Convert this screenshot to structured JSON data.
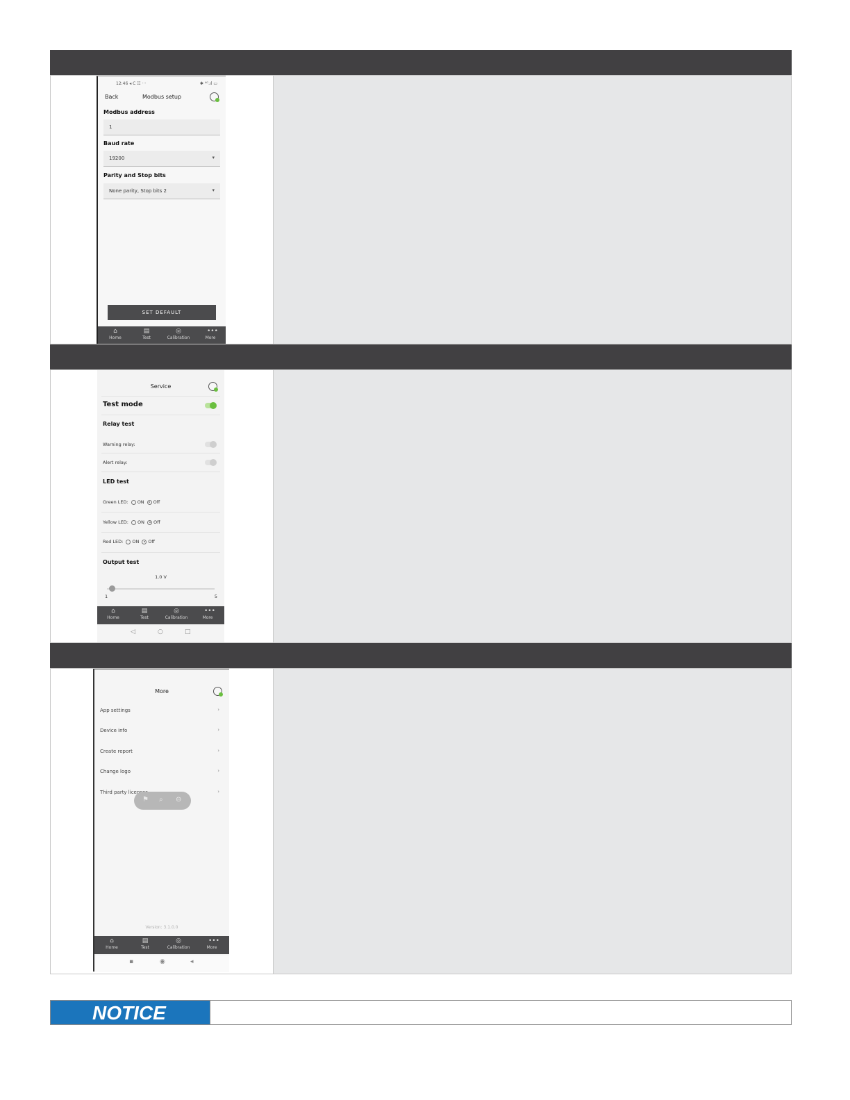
{
  "modbus_screen": {
    "status_left": "12:46 ◂ C ☷ ···",
    "status_right": "✱ ⁴ᴳ.ıl ▭",
    "back": "Back",
    "title": "Modbus setup",
    "address_label": "Modbus address",
    "address_value": "1",
    "baud_label": "Baud rate",
    "baud_value": "19200",
    "parity_label": "Parity and Stop bits",
    "parity_value": "None parity, Stop bits 2",
    "dropdown_glyph": "▾",
    "default_button": "SET DEFAULT"
  },
  "service_screen": {
    "title": "Service",
    "test_mode": "Test mode",
    "relay_test": "Relay test",
    "warning_relay": "Warning relay:",
    "alert_relay": "Alert relay:",
    "led_test": "LED test",
    "green_led": "Green LED:",
    "yellow_led": "Yellow LED:",
    "red_led": "Red LED:",
    "on_label": "ON",
    "off_label": "Off",
    "output_test": "Output test",
    "output_value": "1.0 V",
    "slider_min": "1",
    "slider_max": "5",
    "slider_level": 0.05
  },
  "more_screen": {
    "title": "More",
    "items": [
      {
        "label": "App settings",
        "chevron": "›"
      },
      {
        "label": "Device info",
        "chevron": "›"
      },
      {
        "label": "Create report",
        "chevron": "›"
      },
      {
        "label": "Change logo",
        "chevron": "›"
      },
      {
        "label": "Third party licenses",
        "chevron": "›"
      }
    ],
    "version": "Version: 3.1.0.0"
  },
  "tabbar": {
    "home": "Home",
    "test": "Test",
    "calibration": "Calibration",
    "more": "More"
  },
  "notice": {
    "label": "NOTICE"
  },
  "colors": {
    "band": "#414042",
    "description_bg": "#e6e7e8",
    "notice_blue": "#1b75bc",
    "toggle_on": "#6abf3f"
  }
}
